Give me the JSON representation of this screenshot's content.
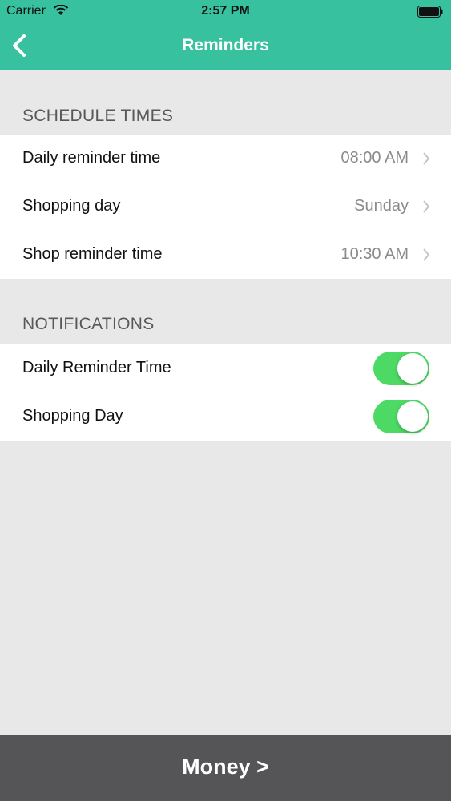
{
  "status_bar": {
    "carrier": "Carrier",
    "time": "2:57 PM",
    "wifi_icon": "wifi-icon",
    "battery_icon": "battery-icon"
  },
  "nav": {
    "title": "Reminders",
    "back_icon": "chevron-left-icon",
    "bar_color": "#37c19e"
  },
  "schedule": {
    "header": "SCHEDULE TIMES",
    "items": [
      {
        "label": "Daily reminder time",
        "value": "08:00 AM"
      },
      {
        "label": "Shopping day",
        "value": "Sunday"
      },
      {
        "label": "Shop reminder time",
        "value": "10:30 AM"
      }
    ]
  },
  "notifications": {
    "header": "NOTIFICATIONS",
    "toggle_color": "#4cd964",
    "items": [
      {
        "label": "Daily Reminder Time",
        "on": true
      },
      {
        "label": "Shopping Day",
        "on": true
      }
    ]
  },
  "bottom": {
    "label": "Money >",
    "color": "#555456"
  }
}
